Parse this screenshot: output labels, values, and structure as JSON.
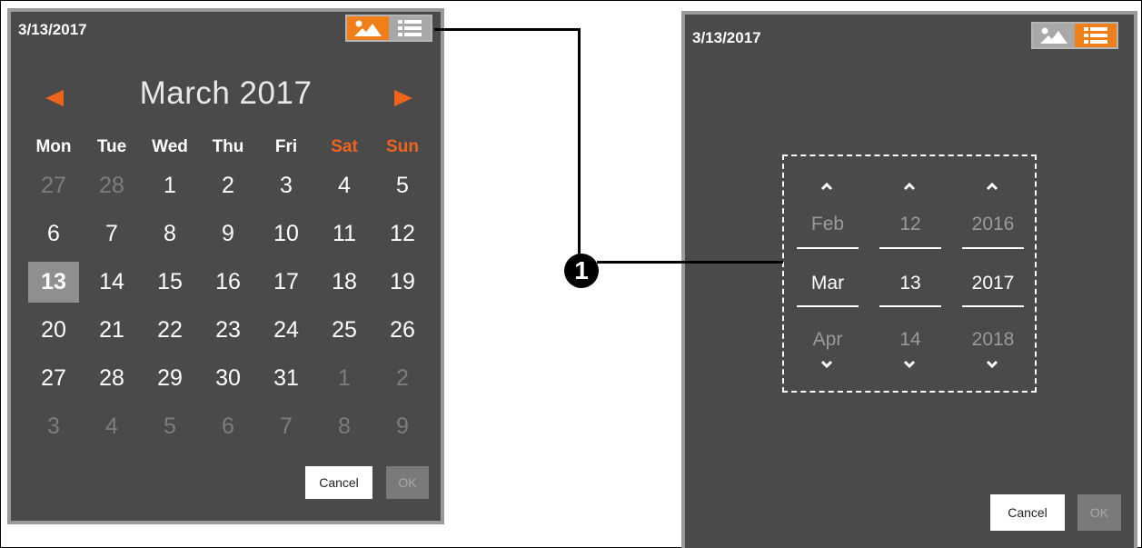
{
  "left_panel": {
    "date_title": "3/13/2017",
    "month_title": "March 2017",
    "days_of_week": [
      {
        "label": "Mon",
        "weekend": false
      },
      {
        "label": "Tue",
        "weekend": false
      },
      {
        "label": "Wed",
        "weekend": false
      },
      {
        "label": "Thu",
        "weekend": false
      },
      {
        "label": "Fri",
        "weekend": false
      },
      {
        "label": "Sat",
        "weekend": true
      },
      {
        "label": "Sun",
        "weekend": true
      }
    ],
    "weeks": [
      [
        {
          "d": "27",
          "o": true
        },
        {
          "d": "28",
          "o": true
        },
        {
          "d": "1"
        },
        {
          "d": "2"
        },
        {
          "d": "3"
        },
        {
          "d": "4"
        },
        {
          "d": "5"
        }
      ],
      [
        {
          "d": "6"
        },
        {
          "d": "7"
        },
        {
          "d": "8"
        },
        {
          "d": "9"
        },
        {
          "d": "10"
        },
        {
          "d": "11"
        },
        {
          "d": "12"
        }
      ],
      [
        {
          "d": "13",
          "sel": true
        },
        {
          "d": "14"
        },
        {
          "d": "15"
        },
        {
          "d": "16"
        },
        {
          "d": "17"
        },
        {
          "d": "18"
        },
        {
          "d": "19"
        }
      ],
      [
        {
          "d": "20"
        },
        {
          "d": "21"
        },
        {
          "d": "22"
        },
        {
          "d": "23"
        },
        {
          "d": "24"
        },
        {
          "d": "25"
        },
        {
          "d": "26"
        }
      ],
      [
        {
          "d": "27"
        },
        {
          "d": "28"
        },
        {
          "d": "29"
        },
        {
          "d": "30"
        },
        {
          "d": "31"
        },
        {
          "d": "1",
          "o": true
        },
        {
          "d": "2",
          "o": true
        }
      ],
      [
        {
          "d": "3",
          "o": true
        },
        {
          "d": "4",
          "o": true
        },
        {
          "d": "5",
          "o": true
        },
        {
          "d": "6",
          "o": true
        },
        {
          "d": "7",
          "o": true
        },
        {
          "d": "8",
          "o": true
        },
        {
          "d": "9",
          "o": true
        }
      ]
    ],
    "cancel_label": "Cancel",
    "ok_label": "OK"
  },
  "right_panel": {
    "date_title": "3/13/2017",
    "spinner": {
      "month": {
        "prev": "Feb",
        "current": "Mar",
        "next": "Apr"
      },
      "day": {
        "prev": "12",
        "current": "13",
        "next": "14"
      },
      "year": {
        "prev": "2016",
        "current": "2017",
        "next": "2018"
      }
    },
    "cancel_label": "Cancel",
    "ok_label": "OK"
  },
  "callout": {
    "number": "1"
  },
  "icons": {
    "calendar_view": "mountain-image-icon",
    "list_view": "list-icon"
  },
  "colors": {
    "accent": "#f07f1a",
    "panel_bg": "#4a4a4a",
    "panel_border": "#9a9a9a",
    "weekend": "#f0641e"
  }
}
